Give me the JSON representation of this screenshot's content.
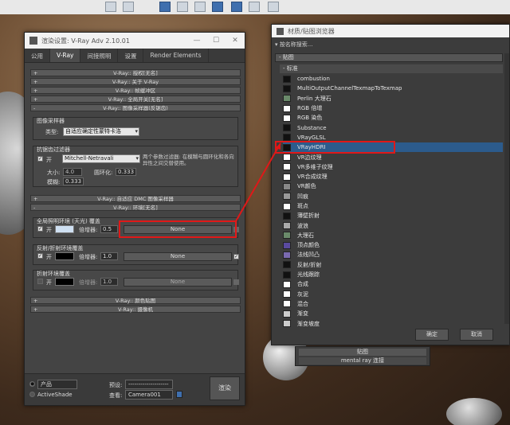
{
  "render_setup": {
    "title": "渲染设置: V-Ray Adv 2.10.01",
    "tabs": [
      "公用",
      "V-Ray",
      "间接照明",
      "设置",
      "Render Elements"
    ],
    "rollouts_top": [
      "V-Ray:: 授权[无名]",
      "V-Ray:: 关于 V-Ray",
      "V-Ray:: 帧缓冲区",
      "V-Ray:: 全局开关[无名]",
      "V-Ray:: 图像采样器(反锯齿)"
    ],
    "image_sampler": {
      "group_label": "图像采样器",
      "type_label": "类型:",
      "type_value": "自适应确定性蒙特卡洛"
    },
    "aa_filter": {
      "group_label": "抗锯齿过滤器",
      "on_label": "开",
      "filter_value": "Mitchell-Netravali",
      "description": "两个参数过滤器: 在模糊与圆环化和各向异性之间交替使用。",
      "size_label": "大小:",
      "size_value": "4.0",
      "ring_label": "圆环化:",
      "ring_value": "0.333",
      "blur_label": "模糊:",
      "blur_value": "0.333"
    },
    "rollout_dmc": "V-Ray:: 自适应 DMC 图像采样器",
    "rollout_env": "V-Ray:: 环境[无名]",
    "gi_env": {
      "label": "全局照明环境 (天光) 覆盖",
      "on_label": "开",
      "multiplier_label": "倍增器:",
      "multiplier_value": "0.5",
      "map_value": "None"
    },
    "refl_env": {
      "label": "反射/折射环境覆盖",
      "on_label": "开",
      "multiplier_label": "倍增器:",
      "multiplier_value": "1.0",
      "map_value": "None"
    },
    "refr_env": {
      "label": "折射环境覆盖",
      "on_label": "开",
      "multiplier_label": "倍增器:",
      "multiplier_value": "1.0",
      "map_value": "None"
    },
    "rollouts_bottom": [
      "V-Ray:: 颜色贴图",
      "V-Ray:: 摄像机"
    ],
    "bottom": {
      "mode_value": "产品",
      "activeshade": "ActiveShade",
      "preset_label": "预设:",
      "preset_value": "--------------------",
      "view_label": "查看:",
      "view_value": "Camera001",
      "render_button": "渲染"
    }
  },
  "material_browser": {
    "title": "材质/贴图浏览器",
    "search_placeholder": "按名称搜索...",
    "section": "- 贴图",
    "subsection": "- 标准",
    "items": [
      {
        "label": "combustion",
        "color": "#111111"
      },
      {
        "label": "MultiOutputChannelTexmapToTexmap",
        "color": "#111111"
      },
      {
        "label": "Perlin 大理石",
        "color": "#6a8a6a"
      },
      {
        "label": "RGB 倍增",
        "color": "#ffffff"
      },
      {
        "label": "RGB 染色",
        "color": "#ffffff"
      },
      {
        "label": "Substance",
        "color": "#111111"
      },
      {
        "label": "VRayGLSL",
        "color": "#111111"
      },
      {
        "label": "VRayHDRI",
        "color": "#111111"
      },
      {
        "label": "VR边纹理",
        "color": "#ffffff"
      },
      {
        "label": "VR多维子纹理",
        "color": "#ffffff"
      },
      {
        "label": "VR合成纹理",
        "color": "#ffffff"
      },
      {
        "label": "VR颜色",
        "color": "#888888"
      },
      {
        "label": "凹痕",
        "color": "#999999"
      },
      {
        "label": "斑点",
        "color": "#ffffff"
      },
      {
        "label": "薄壁折射",
        "color": "#111111"
      },
      {
        "label": "波浪",
        "color": "#aaaaaa"
      },
      {
        "label": "大理石",
        "color": "#6a8a6a"
      },
      {
        "label": "顶点颜色",
        "color": "#5a4aa0"
      },
      {
        "label": "法线凹凸",
        "color": "#7a6ab0"
      },
      {
        "label": "反射/折射",
        "color": "#111111"
      },
      {
        "label": "光线跟踪",
        "color": "#111111"
      },
      {
        "label": "合成",
        "color": "#ffffff"
      },
      {
        "label": "灰泥",
        "color": "#ffffff"
      },
      {
        "label": "混合",
        "color": "#ffffff"
      },
      {
        "label": "渐变",
        "color": "#cccccc"
      },
      {
        "label": "渐变坡度",
        "color": "#cccccc"
      }
    ],
    "highlighted_index": 7,
    "ok_button": "确定",
    "cancel_button": "取消"
  },
  "bottom_panel": {
    "section": "贴图",
    "item": "mental ray 连接"
  },
  "colors": {
    "highlight": "#e01818",
    "selection": "#2c5b8c"
  }
}
